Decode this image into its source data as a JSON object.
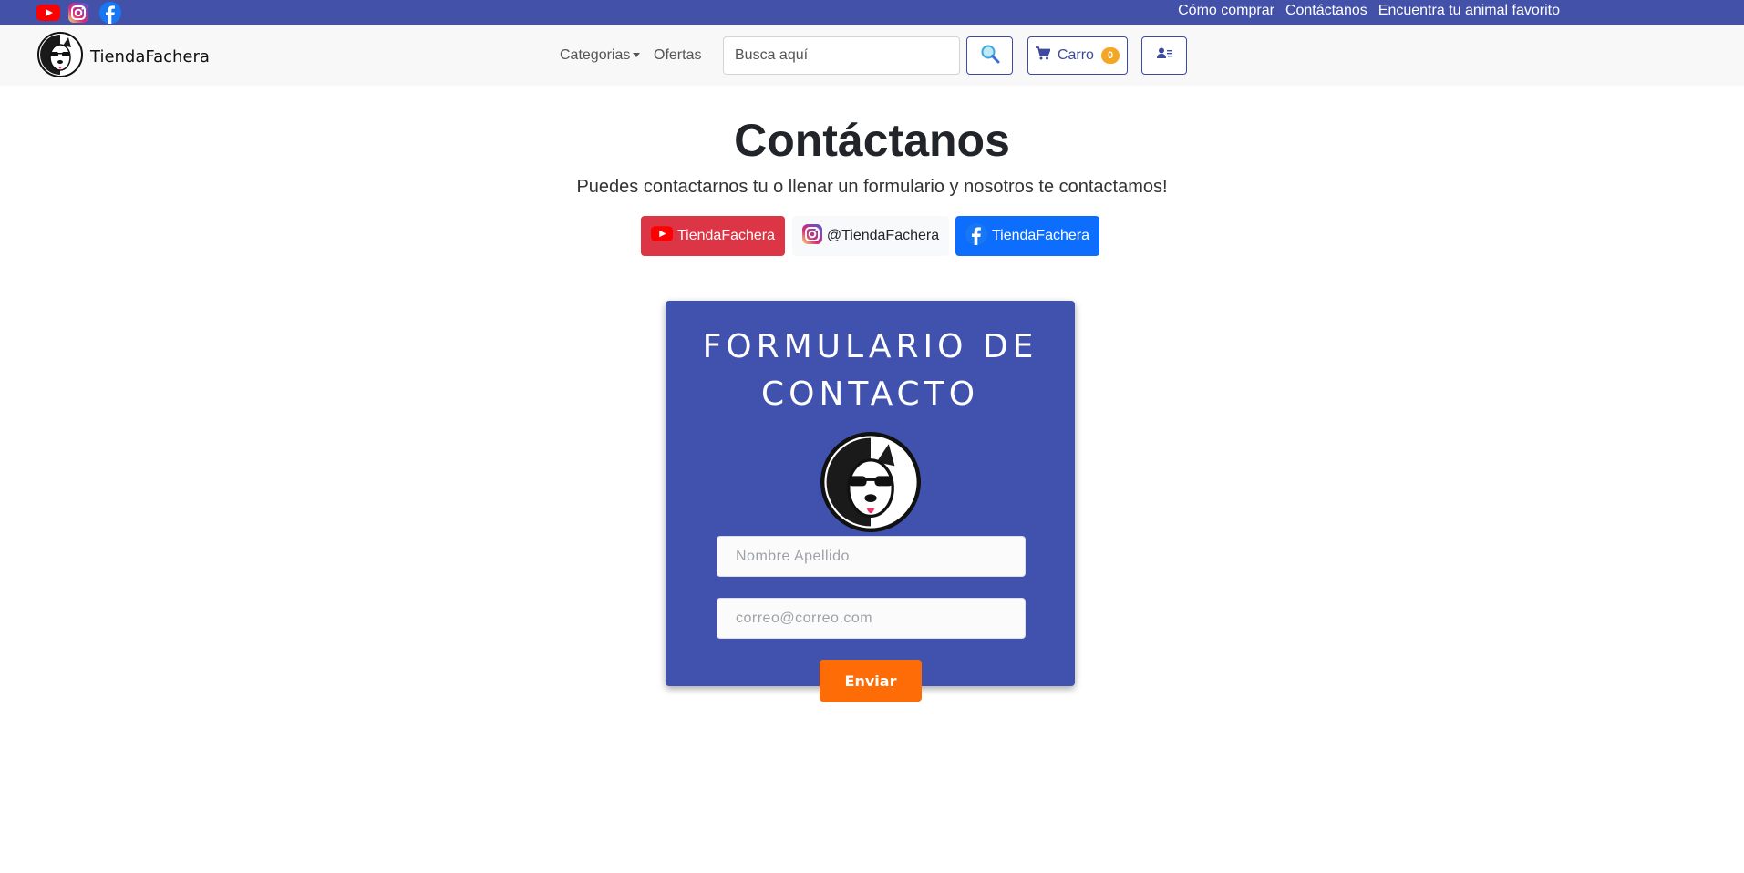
{
  "topbar": {
    "social_icons": [
      "youtube-icon",
      "instagram-icon",
      "facebook-icon"
    ],
    "links": [
      "Cómo comprar",
      "Contáctanos",
      "Encuentra tu animal favorito"
    ]
  },
  "navbar": {
    "brand": "TiendaFachera",
    "categories": "Categorias",
    "offers": "Ofertas",
    "search_placeholder": "Busca aquí",
    "cart_label": "Carro",
    "cart_count": "0"
  },
  "main": {
    "title": "Contáctanos",
    "subtitle": "Puedes contactarnos tu o llenar un formulario y nosotros te contactamos!",
    "social_buttons": {
      "youtube": "TiendaFachera",
      "instagram": "@TiendaFachera",
      "facebook": "TiendaFachera"
    }
  },
  "form": {
    "title": "FORMULARIO DE CONTACTO",
    "name_placeholder": "Nombre Apellido",
    "email_placeholder": "correo@correo.com",
    "submit": "Enviar"
  },
  "colors": {
    "topbar": "#4451a9",
    "card": "#4052ae",
    "accent_orange": "#fd6c07",
    "youtube": "#dc3545",
    "facebook": "#0d6efd"
  }
}
